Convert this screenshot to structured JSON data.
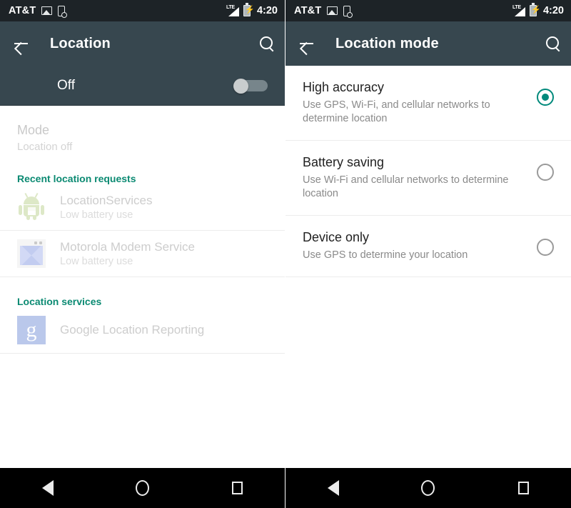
{
  "statusbar": {
    "carrier": "AT&T",
    "time": "4:20",
    "network_label": "LTE",
    "icons": [
      "photo-icon",
      "phone-with-badge-icon",
      "lte-signal-icon",
      "battery-charging-icon"
    ]
  },
  "left_screen": {
    "appbar": {
      "title": "Location",
      "back": "back-arrow-icon",
      "search": "search-icon"
    },
    "master_switch": {
      "label": "Off",
      "state": "off"
    },
    "mode_row": {
      "title": "Mode",
      "subtitle": "Location off"
    },
    "recent_header": "Recent location requests",
    "recent_items": [
      {
        "name": "LocationServices",
        "detail": "Low battery use",
        "icon": "android-robot-icon"
      },
      {
        "name": "Motorola Modem Service",
        "detail": "Low battery use",
        "icon": "motorola-modem-icon"
      }
    ],
    "services_header": "Location services",
    "services_items": [
      {
        "name": "Google Location Reporting",
        "icon": "google-icon",
        "glyph": "g"
      }
    ]
  },
  "right_screen": {
    "appbar": {
      "title": "Location mode",
      "back": "back-arrow-icon",
      "search": "search-icon"
    },
    "options": [
      {
        "title": "High accuracy",
        "subtitle": "Use GPS, Wi-Fi, and cellular networks to determine location",
        "selected": true
      },
      {
        "title": "Battery saving",
        "subtitle": "Use Wi-Fi and cellular networks to determine location",
        "selected": false
      },
      {
        "title": "Device only",
        "subtitle": "Use GPS to determine your location",
        "selected": false
      }
    ]
  },
  "navbar": {
    "back": "nav-back-icon",
    "home": "nav-home-icon",
    "recents": "nav-recents-icon"
  },
  "colors": {
    "appbar": "#37474F",
    "statusbar": "#1D2327",
    "accent_teal": "#00897B",
    "section_header": "#0B8A72",
    "navbar": "#000000"
  }
}
